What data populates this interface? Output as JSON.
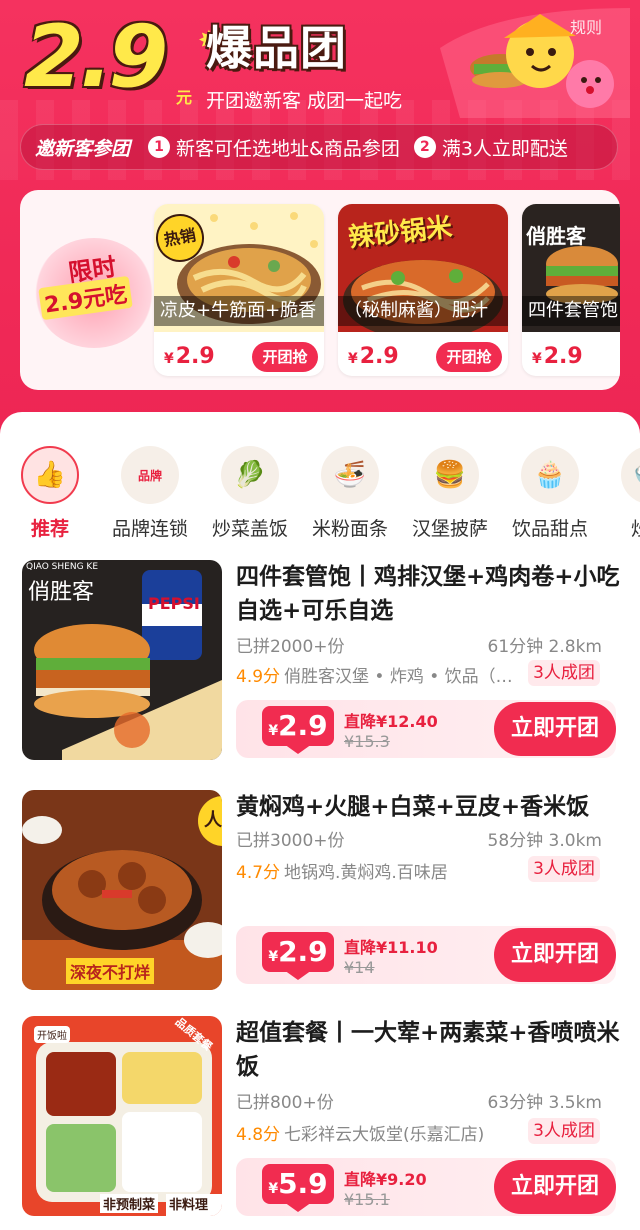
{
  "header": {
    "logo_number": "2.9",
    "logo_unit": "元",
    "logo_title": "爆品团",
    "logo_subtitle": "开团邀新客 成团一起吃",
    "rules_link": "规则"
  },
  "banner": {
    "title": "邀新客参团",
    "step1_num": "1",
    "step1": "新客可任选地址&商品参团",
    "step2_num": "2",
    "step2": "满3人立即配送"
  },
  "limited_deal": {
    "line1": "限时",
    "line2": "2.9元吃",
    "products": [
      {
        "name": "凉皮+牛筋面+脆香",
        "currency": "¥",
        "price": "2.9",
        "button": "开团抢",
        "tag": "热销"
      },
      {
        "name": "（秘制麻酱）肥汁",
        "currency": "¥",
        "price": "2.9",
        "button": "开团抢",
        "overlay": "辣砂锅米"
      },
      {
        "name": "四件套管饱",
        "currency": "¥",
        "price": "2.9",
        "brand": "俏胜客"
      }
    ]
  },
  "categories": [
    {
      "label": "推荐",
      "icon": "thumbs-up-icon",
      "glyph": "👍"
    },
    {
      "label": "品牌连锁",
      "icon": "brand-badge-icon",
      "glyph": "品牌"
    },
    {
      "label": "炒菜盖饭",
      "icon": "stir-fry-icon",
      "glyph": "🥬"
    },
    {
      "label": "米粉面条",
      "icon": "noodles-icon",
      "glyph": "🍜"
    },
    {
      "label": "汉堡披萨",
      "icon": "burger-icon",
      "glyph": "🍔"
    },
    {
      "label": "饮品甜点",
      "icon": "dessert-icon",
      "glyph": "🧁"
    },
    {
      "label": "炒饭",
      "icon": "fried-rice-icon",
      "glyph": "🍚"
    }
  ],
  "listings": [
    {
      "title": "四件套管饱丨鸡排汉堡+鸡肉卷+小吃自选+可乐自选",
      "sold": "已拼2000+份",
      "time_distance": "61分钟  2.8km",
      "rating": "4.9分",
      "shop": "俏胜客汉堡 • 炸鸡 • 饮品（…",
      "badge": "3人成团",
      "currency": "¥",
      "price": "2.9",
      "discount": "直降¥12.40",
      "original": "¥15.3",
      "button": "立即开团",
      "image_brand": "俏胜客",
      "image_brand_en": "QIAO SHENG KE",
      "image_cola": "PEPSI"
    },
    {
      "title": "黄焖鸡+火腿+白菜+豆皮+香米饭",
      "sold": "已拼3000+份",
      "time_distance": "58分钟  3.0km",
      "rating": "4.7分",
      "shop": "地锅鸡.黄焖鸡.百味居",
      "badge": "3人成团",
      "currency": "¥",
      "price": "2.9",
      "discount": "直降¥11.10",
      "original": "¥14",
      "button": "立即开团",
      "image_tag": "深夜不打烊",
      "image_corner": "人气"
    },
    {
      "title": "超值套餐丨一大荤+两素菜+香喷喷米饭",
      "sold": "已拼800+份",
      "time_distance": "63分钟  3.5km",
      "rating": "4.8分",
      "shop": "七彩祥云大饭堂(乐嘉汇店)",
      "badge": "3人成团",
      "currency": "¥",
      "price": "5.9",
      "discount": "直降¥9.20",
      "original": "¥15.1",
      "button": "立即开团",
      "image_tag1": "非预制菜",
      "image_tag2": "非料理包",
      "image_corner": "品质套餐",
      "image_sticker": "开饭啦"
    }
  ],
  "colors": {
    "primary": "#f12c50",
    "hero_bg": "#f5325f",
    "rating": "#ff8a00",
    "logo_yellow": "#ffe94a"
  }
}
